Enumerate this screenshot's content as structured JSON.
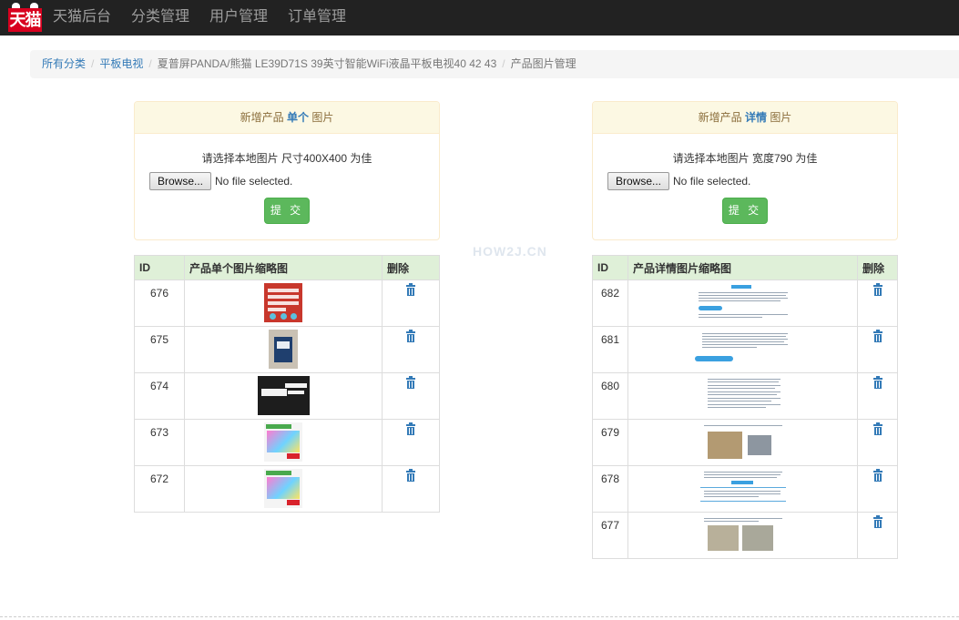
{
  "nav": {
    "logo_text": "天猫",
    "brand": "天猫后台",
    "items": [
      "分类管理",
      "用户管理",
      "订单管理"
    ]
  },
  "breadcrumb": {
    "links": [
      "所有分类",
      "平板电视"
    ],
    "product": "夏普屏PANDA/熊猫 LE39D71S 39英寸智能WiFi液晶平板电视40 42 43",
    "current": "产品图片管理"
  },
  "single_panel": {
    "heading_prefix": "新增产品 ",
    "heading_em": "单个",
    "heading_suffix": " 图片",
    "hint": "请选择本地图片 尺寸400X400 为佳",
    "browse_label": "Browse...",
    "file_status": "No file selected.",
    "submit_label": "提 交"
  },
  "detail_panel": {
    "heading_prefix": "新增产品 ",
    "heading_em": "详情",
    "heading_suffix": " 图片",
    "hint": "请选择本地图片 宽度790 为佳",
    "browse_label": "Browse...",
    "file_status": "No file selected.",
    "submit_label": "提 交"
  },
  "watermark": "HOW2J.CN",
  "single_table": {
    "headers": [
      "ID",
      "产品单个图片缩略图",
      "删除"
    ],
    "rows": [
      {
        "id": "676"
      },
      {
        "id": "675"
      },
      {
        "id": "674"
      },
      {
        "id": "673"
      },
      {
        "id": "672"
      }
    ]
  },
  "detail_table": {
    "headers": [
      "ID",
      "产品详情图片缩略图",
      "删除"
    ],
    "rows": [
      {
        "id": "682"
      },
      {
        "id": "681"
      },
      {
        "id": "680"
      },
      {
        "id": "679"
      },
      {
        "id": "678"
      },
      {
        "id": "677"
      }
    ]
  },
  "icons": {
    "delete": "trash-icon"
  },
  "colors": {
    "navbar": "#222222",
    "logo": "#d8001f",
    "link": "#337ab7",
    "panel_heading": "#fcf8e3",
    "table_header": "#dff0d8",
    "submit": "#5cb85c"
  }
}
